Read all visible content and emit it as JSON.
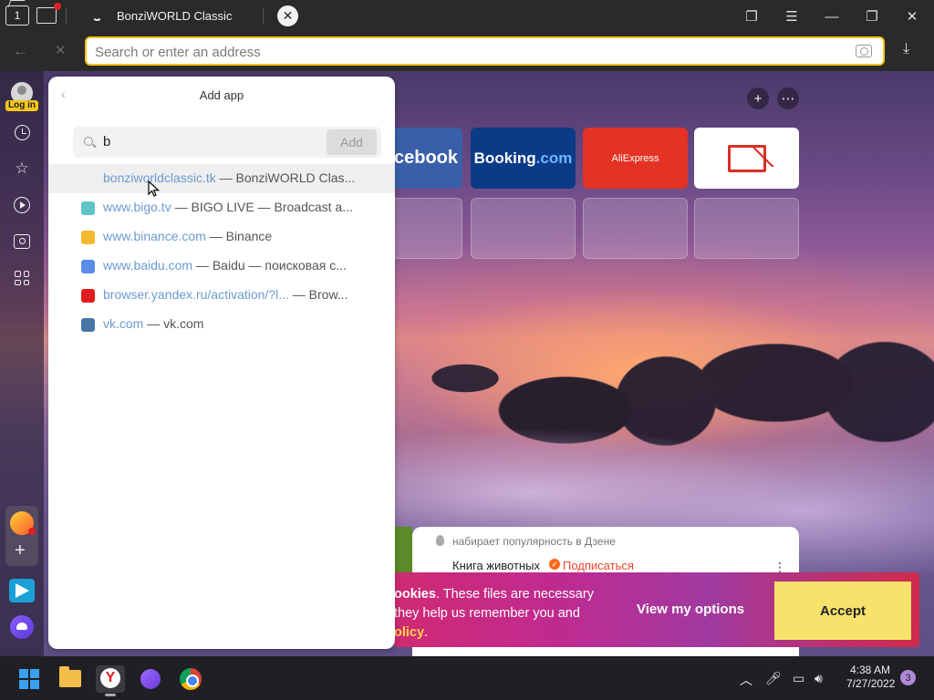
{
  "tab": {
    "title": "BonziWORLD Classic",
    "tabs_count": "1"
  },
  "address_bar": {
    "placeholder": "Search or enter an address"
  },
  "sidebar": {
    "login_label": "Log in"
  },
  "tiles": {
    "facebook": "cebook",
    "booking_main": "Booking",
    "booking_dot": ".com",
    "aliexpress": "AliExpress"
  },
  "panel": {
    "title": "Add app",
    "search_value": "b",
    "add_label": "Add",
    "suggestions": [
      {
        "url": "bonziworldclassic.tk",
        "sep": " — ",
        "desc": "BonziWORLD Clas...",
        "icon": "none",
        "color": ""
      },
      {
        "url": "www.bigo.tv",
        "sep": " — ",
        "desc": "BIGO LIVE — Broadcast a...",
        "icon": "bigo-icon",
        "color": "#5fc3c8"
      },
      {
        "url": "www.binance.com",
        "sep": " — ",
        "desc": "Binance",
        "icon": "binance-icon",
        "color": "#f3ba2f"
      },
      {
        "url": "www.baidu.com",
        "sep": " — ",
        "desc": "Baidu — поисковая с...",
        "icon": "baidu-icon",
        "color": "#5b8de8"
      },
      {
        "url": "browser.yandex.ru/activation/?l...",
        "sep": " — ",
        "desc": "Brow...",
        "icon": "yandex-icon",
        "color": "#e21c1c"
      },
      {
        "url": "vk.com",
        "sep": " — ",
        "desc": "vk.com",
        "icon": "vk-icon",
        "color": "#4a76a8"
      }
    ]
  },
  "zen": {
    "subtitle": "набирает популярность в Дзене",
    "channel": "Книга животных",
    "follow": "Подписаться"
  },
  "cookie": {
    "text_bold": "ookies",
    "text_1": ". These files are necessary",
    "text_2": "they help us remember you and",
    "text_link": "olicy",
    "text_end": ".",
    "view_options": "View my options",
    "accept": "Accept"
  },
  "taskbar": {
    "time": "4:38 AM",
    "date": "7/27/2022",
    "notifications": "3"
  },
  "colors": {
    "accent": "#f5c518",
    "link": "#6b9ad1",
    "cookie_accept": "#f7e26b"
  }
}
